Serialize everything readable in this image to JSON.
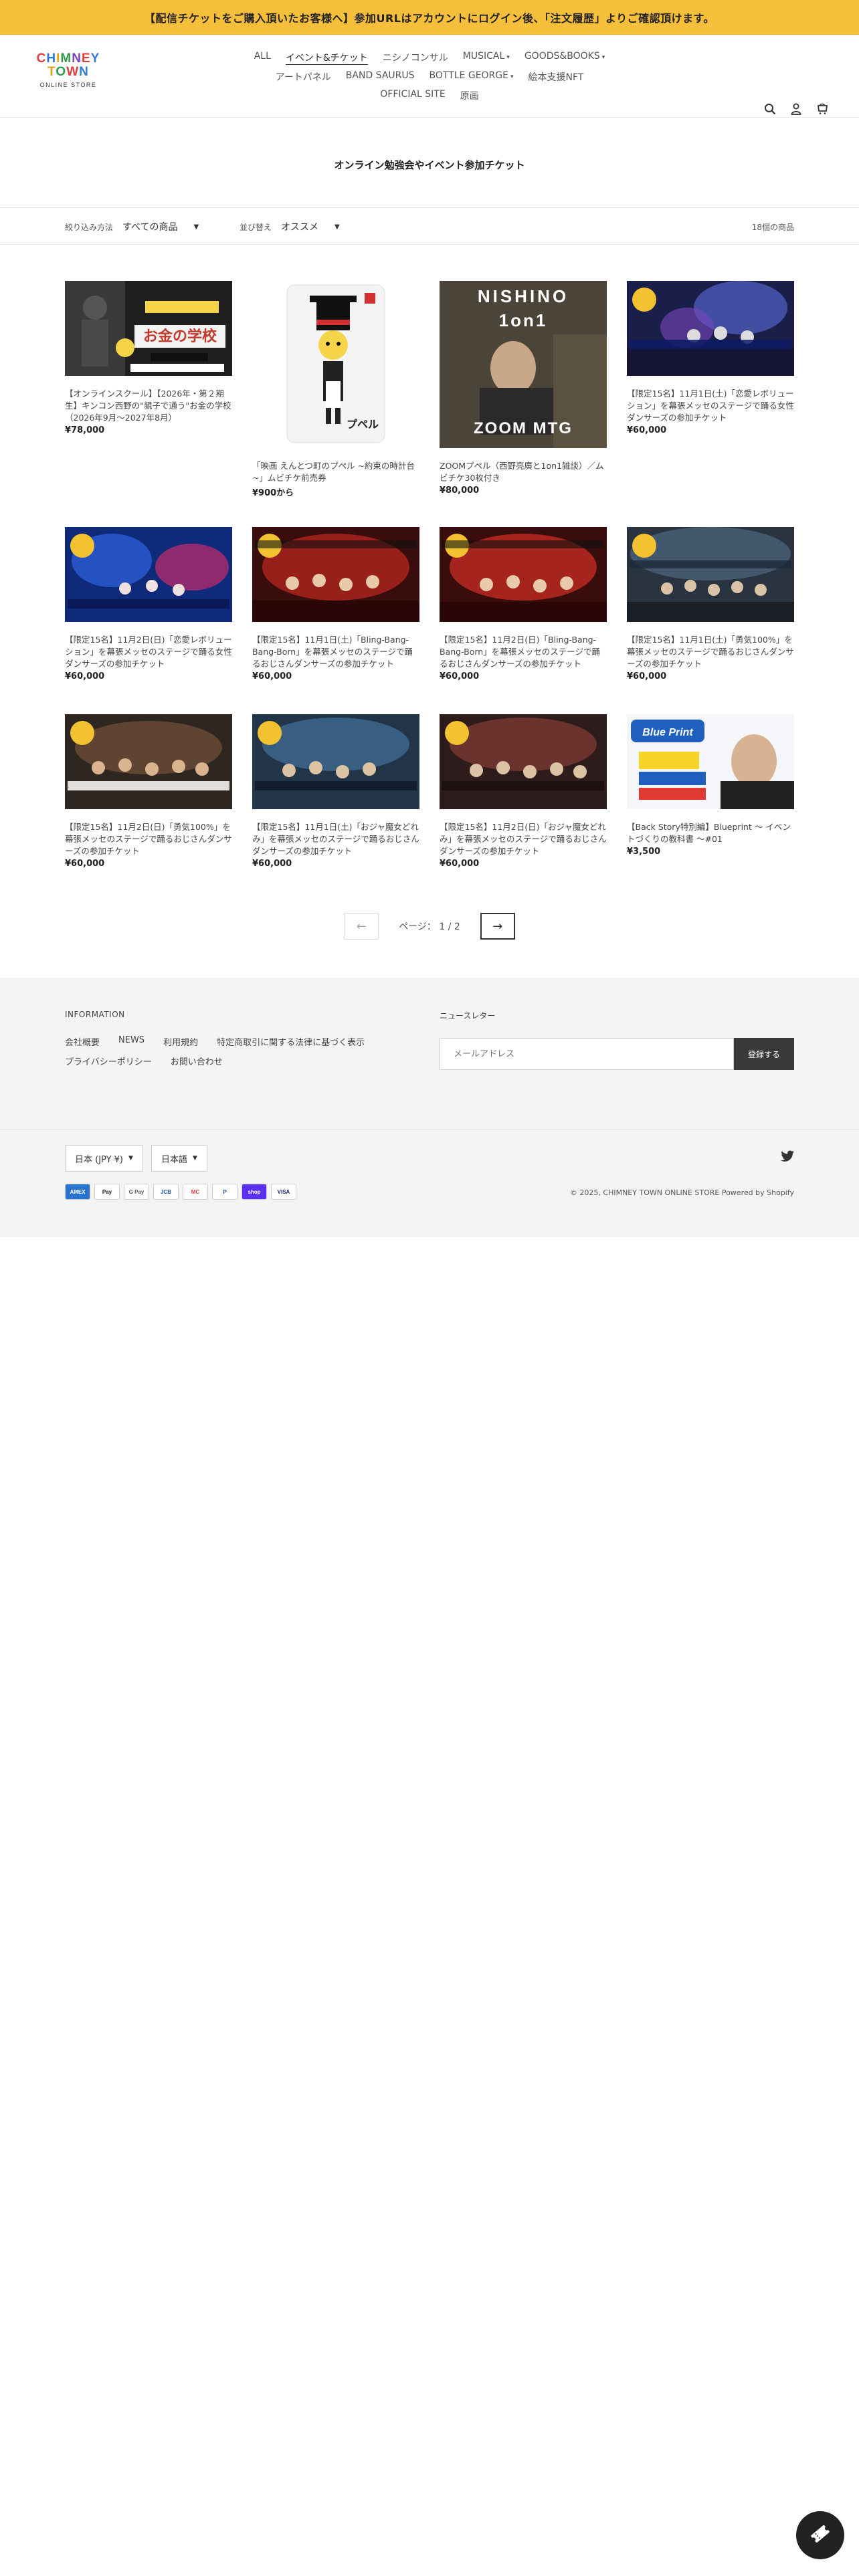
{
  "announcement": "【配信チケットをご購入頂いたお客様へ】参加URLはアカウントにログイン後、「注文履歴」よりご確認頂けます。",
  "logo": {
    "line1": "CHIMNEY",
    "line2": "TOWN",
    "line3": "ONLINE STORE"
  },
  "nav": {
    "row1": [
      {
        "label": "ALL"
      },
      {
        "label": "イベント&チケット",
        "active": true
      },
      {
        "label": "ニシノコンサル"
      },
      {
        "label": "MUSICAL",
        "dropdown": true
      },
      {
        "label": "GOODS&BOOKS",
        "dropdown": true
      }
    ],
    "row2": [
      {
        "label": "アートパネル"
      },
      {
        "label": "BAND SAURUS"
      },
      {
        "label": "BOTTLE GEORGE",
        "dropdown": true
      },
      {
        "label": "絵本支援NFT"
      }
    ],
    "row3": [
      {
        "label": "OFFICIAL SITE"
      },
      {
        "label": "原画"
      }
    ]
  },
  "header_icons": [
    "search-icon",
    "account-icon",
    "cart-icon"
  ],
  "collection": {
    "title": "オンライン勉強会やイベント参加チケット"
  },
  "filter": {
    "filter_label": "絞り込み方法",
    "filter_value": "すべての商品",
    "sort_label": "並び替え",
    "sort_value": "オススメ",
    "count": "18個の商品"
  },
  "products": [
    {
      "title": "【オンラインスクール】【2026年・第２期生】キンコン西野の\"親子で通う\"お金の学校（2026年9月〜2027年8月）",
      "price": "¥78,000",
      "image_text": "お金の学校"
    },
    {
      "title": "「映画 えんとつ町のプペル ~約束の時計台~」ムビチケ前売券",
      "price": "¥900から",
      "image_text": "プペル"
    },
    {
      "title": "ZOOMプペル（西野亮廣と1on1雑談）／ムビチケ30枚付き",
      "price": "¥80,000",
      "image_text": "NISHINO 1on1"
    },
    {
      "title": "【限定15名】11月1日(土)「恋愛レボリューション」を幕張メッセのステージで踊る女性ダンサーズの参加チケット",
      "price": "¥60,000",
      "image_text": ""
    },
    {
      "title": "【限定15名】11月2日(日)「恋愛レボリューション」を幕張メッセのステージで踊る女性ダンサーズの参加チケット",
      "price": "¥60,000",
      "image_text": ""
    },
    {
      "title": "【限定15名】11月1日(土)「Bling-Bang-Bang-Born」を幕張メッセのステージで踊るおじさんダンサーズの参加チケット",
      "price": "¥60,000",
      "image_text": ""
    },
    {
      "title": "【限定15名】11月2日(日)「Bling-Bang-Bang-Born」を幕張メッセのステージで踊るおじさんダンサーズの参加チケット",
      "price": "¥60,000",
      "image_text": ""
    },
    {
      "title": "【限定15名】11月1日(土)「勇気100%」を幕張メッセのステージで踊るおじさんダンサーズの参加チケット",
      "price": "¥60,000",
      "image_text": ""
    },
    {
      "title": "【限定15名】11月2日(日)「勇気100%」を幕張メッセのステージで踊るおじさんダンサーズの参加チケット",
      "price": "¥60,000",
      "image_text": ""
    },
    {
      "title": "【限定15名】11月1日(土)「おジャ魔女どれみ」を幕張メッセのステージで踊るおじさんダンサーズの参加チケット",
      "price": "¥60,000",
      "image_text": ""
    },
    {
      "title": "【限定15名】11月2日(日)「おジャ魔女どれみ」を幕張メッセのステージで踊るおじさんダンサーズの参加チケット",
      "price": "¥60,000",
      "image_text": ""
    },
    {
      "title": "【Back Story特別編】Blueprint 〜 イベントづくりの教科書 〜#01",
      "price": "¥3,500",
      "image_text": "Blue Print"
    }
  ],
  "pagination": {
    "prev": "←",
    "label": "ページ： 1 / 2",
    "next": "→"
  },
  "footer": {
    "info_heading": "INFORMATION",
    "links": [
      "会社概要",
      "NEWS",
      "利用規約",
      "特定商取引に関する法律に基づく表示",
      "プライバシーポリシー",
      "お問い合わせ"
    ],
    "newsletter_heading": "ニュースレター",
    "email_placeholder": "メールアドレス",
    "subscribe": "登録する",
    "currency": "日本 (JPY ¥)",
    "language": "日本語",
    "payments": [
      "AMEX",
      "Pay",
      "G Pay",
      "JCB",
      "MC",
      "P",
      "shop",
      "VISA"
    ],
    "copyright": "© 2025, CHIMNEY TOWN ONLINE STORE Powered by Shopify"
  }
}
